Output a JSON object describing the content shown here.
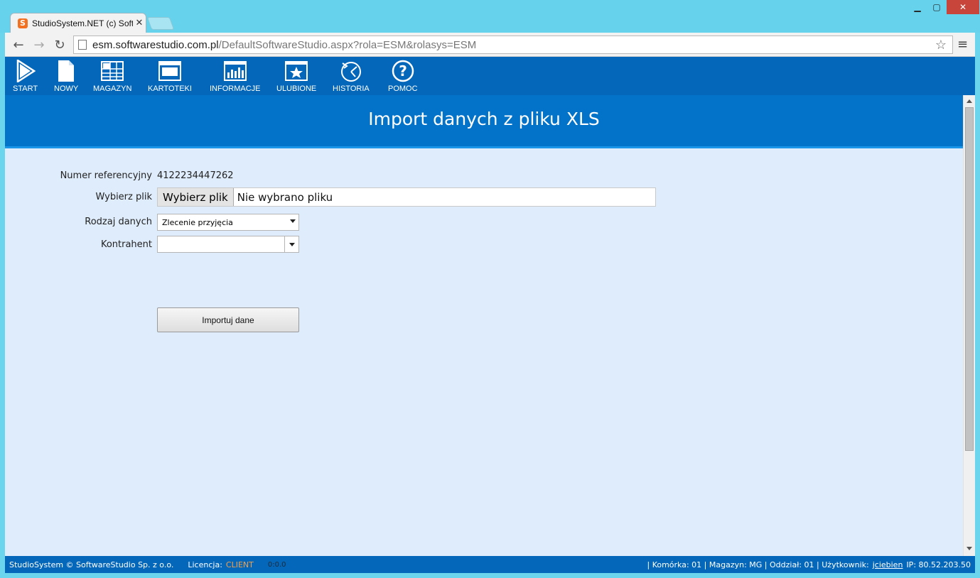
{
  "browser": {
    "tab_title": "StudioSystem.NET (c) Soft",
    "favicon_letter": "S",
    "url_host": "esm.softwarestudio.com.pl",
    "url_path": "/DefaultSoftwareStudio.aspx?rola=ESM&rolasys=ESM"
  },
  "appbar": {
    "items": [
      {
        "label": "START",
        "icon": "play-icon"
      },
      {
        "label": "NOWY",
        "icon": "document-icon"
      },
      {
        "label": "MAGAZYN",
        "icon": "grid-icon"
      },
      {
        "label": "KARTOTEKI",
        "icon": "window-icon"
      },
      {
        "label": "INFORMACJE",
        "icon": "bar-chart-icon"
      },
      {
        "label": "ULUBIONE",
        "icon": "star-icon"
      },
      {
        "label": "HISTORIA",
        "icon": "history-icon"
      },
      {
        "label": "POMOC",
        "icon": "help-icon"
      }
    ]
  },
  "page": {
    "title": "Import danych z pliku XLS"
  },
  "form": {
    "ref_label": "Numer referencyjny",
    "ref_value": "4122234447262",
    "file_label": "Wybierz plik",
    "file_button": "Wybierz plik",
    "file_status": "Nie wybrano pliku",
    "type_label": "Rodzaj danych",
    "type_value": "Zlecenie przyjęcia",
    "contractor_label": "Kontrahent",
    "contractor_value": "",
    "import_button": "Importuj dane"
  },
  "footer": {
    "copyright": "StudioSystem © SoftwareStudio Sp. z o.o.",
    "license_label": "Licencja:",
    "license_value": "CLIENT",
    "timer": "0:0.0",
    "cell": "Komórka: 01",
    "warehouse": "Magazyn: MG",
    "branch": "Oddział: 01",
    "user_label": "Użytkownik:",
    "user_value": "jciebien",
    "ip": "IP: 80.52.203.50"
  },
  "colors": {
    "appbar": "#0567b9",
    "header": "#0273c9",
    "content_bg": "#dfecfb",
    "license_accent": "#f3a04b"
  }
}
